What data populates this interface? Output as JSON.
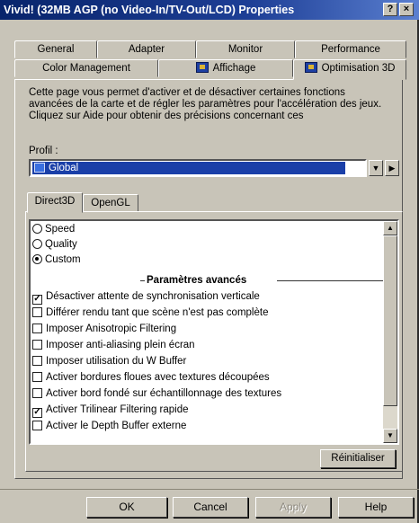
{
  "window": {
    "title": "Vivid! (32MB AGP (no Video-In/TV-Out/LCD) Properties",
    "help_btn": "?",
    "close_btn": "×"
  },
  "tabs_row1": [
    "General",
    "Adapter",
    "Monitor",
    "Performance"
  ],
  "tabs_row2": [
    "Color Management",
    "Affichage",
    "Optimisation 3D"
  ],
  "description": "Cette page vous permet d'activer et de désactiver certaines fonctions avancées de la carte et de régler les paramètres pour l'accélération des jeux. Cliquez sur Aide pour obtenir des précisions concernant ces",
  "profile": {
    "label": "Profil :",
    "value": "Global"
  },
  "subtabs": [
    "Direct3D",
    "OpenGL"
  ],
  "options": {
    "radios": [
      {
        "label": "Speed",
        "checked": false
      },
      {
        "label": "Quality",
        "checked": false
      },
      {
        "label": "Custom",
        "checked": true
      }
    ],
    "section_title": "Paramètres avancés",
    "checkboxes": [
      {
        "label": "Désactiver attente de synchronisation verticale",
        "checked": true
      },
      {
        "label": "Différer rendu tant que scène n'est pas complète",
        "checked": false
      },
      {
        "label": "Imposer Anisotropic Filtering",
        "checked": false
      },
      {
        "label": "Imposer anti-aliasing plein écran",
        "checked": false
      },
      {
        "label": "Imposer utilisation du W Buffer",
        "checked": false
      },
      {
        "label": "Activer bordures floues avec textures découpées",
        "checked": false
      },
      {
        "label": "Activer bord fondé sur échantillonnage des textures",
        "checked": false
      },
      {
        "label": "Activer Trilinear Filtering rapide",
        "checked": true
      },
      {
        "label": "Activer le Depth Buffer externe",
        "checked": false
      }
    ]
  },
  "reset_button": "Réinitialiser",
  "buttons": {
    "ok": "OK",
    "cancel": "Cancel",
    "apply": "Apply",
    "help": "Help"
  },
  "colors": {
    "titlebar": "#08246b",
    "face": "#c8c4b8",
    "selection": "#1a3fa8"
  }
}
